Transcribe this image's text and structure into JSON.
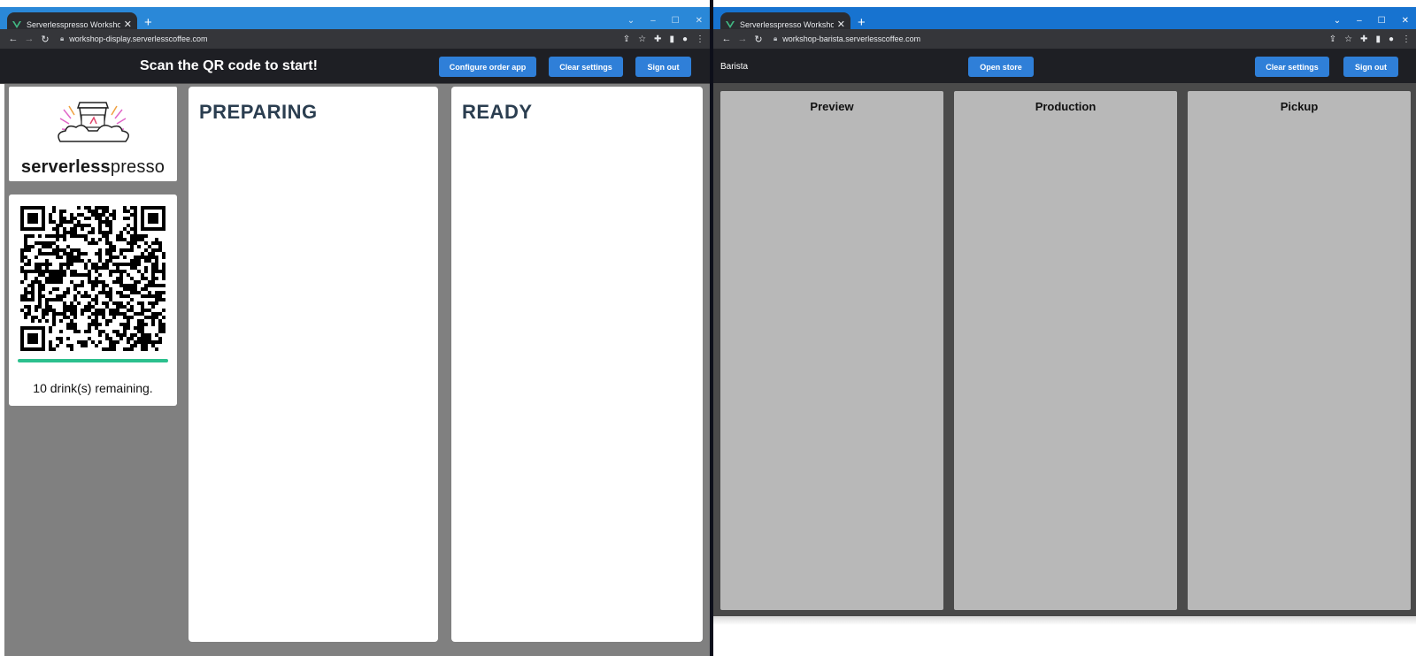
{
  "left_window": {
    "tab_title": "Serverlesspresso Workshop - Dis",
    "url": "workshop-display.serverlesscoffee.com",
    "header": {
      "title": "Scan the QR code to start!",
      "configure_label": "Configure order app",
      "clear_label": "Clear settings",
      "signout_label": "Sign out"
    },
    "logo": {
      "brand_bold": "serverless",
      "brand_light": "presso"
    },
    "qr": {
      "remaining_text": "10 drink(s) remaining.",
      "progress_fraction": 1.0
    },
    "columns": {
      "preparing": "PREPARING",
      "ready": "READY"
    }
  },
  "right_window": {
    "tab_title": "Serverlesspresso Workshop - Bar",
    "url": "workshop-barista.serverlesscoffee.com",
    "header": {
      "label": "Barista",
      "open_store_label": "Open store",
      "clear_label": "Clear settings",
      "signout_label": "Sign out"
    },
    "lanes": {
      "preview": "Preview",
      "production": "Production",
      "pickup": "Pickup"
    }
  },
  "colors": {
    "button": "#2f7fd8",
    "appbar": "#1e1f24",
    "progress": "#2cc08e",
    "heading": "#2b3e50"
  },
  "icons": [
    "vue-favicon",
    "close-icon",
    "new-tab-icon",
    "back-icon",
    "forward-icon",
    "reload-icon",
    "lock-icon",
    "share-icon",
    "star-icon",
    "extensions-icon",
    "sidepanel-icon",
    "profile-icon",
    "menu-icon",
    "minimize-icon",
    "maximize-icon"
  ]
}
